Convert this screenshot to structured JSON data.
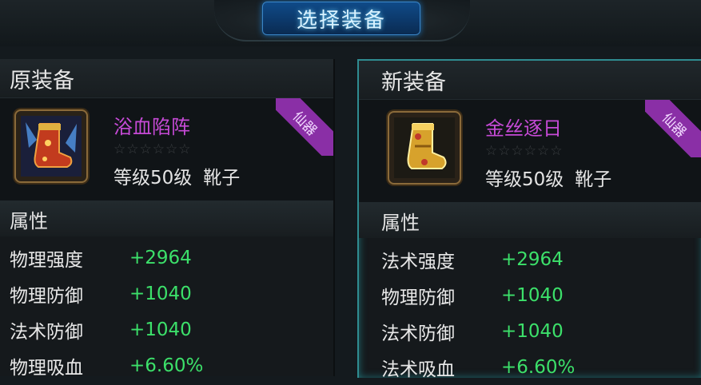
{
  "dialog": {
    "title": "选择装备"
  },
  "left": {
    "header": "原装备",
    "item": {
      "name": "浴血陷阵",
      "stars": "☆☆☆☆☆☆",
      "level": "等级50级",
      "type": "靴子",
      "badge": "仙器",
      "name_color": "#c64ad6"
    },
    "section": "属性",
    "stats": [
      {
        "label": "物理强度",
        "value": "+2964"
      },
      {
        "label": "物理防御",
        "value": "+1040"
      },
      {
        "label": "法术防御",
        "value": "+1040"
      },
      {
        "label": "物理吸血",
        "value": "+6.60%"
      }
    ]
  },
  "right": {
    "header": "新装备",
    "item": {
      "name": "金丝逐日",
      "stars": "☆☆☆☆☆☆",
      "level": "等级50级",
      "type": "靴子",
      "badge": "仙器",
      "name_color": "#c64ad6"
    },
    "section": "属性",
    "stats": [
      {
        "label": "法术强度",
        "value": "+2964"
      },
      {
        "label": "物理防御",
        "value": "+1040"
      },
      {
        "label": "法术防御",
        "value": "+1040"
      },
      {
        "label": "法术吸血",
        "value": "+6.60%"
      }
    ]
  },
  "colors": {
    "stat_value": "#3ce06a",
    "accent_border": "#2f8c91",
    "badge": "#8a2fa6"
  },
  "icons": {
    "left_item": "red-boot-icon",
    "right_item": "gold-boot-icon"
  }
}
